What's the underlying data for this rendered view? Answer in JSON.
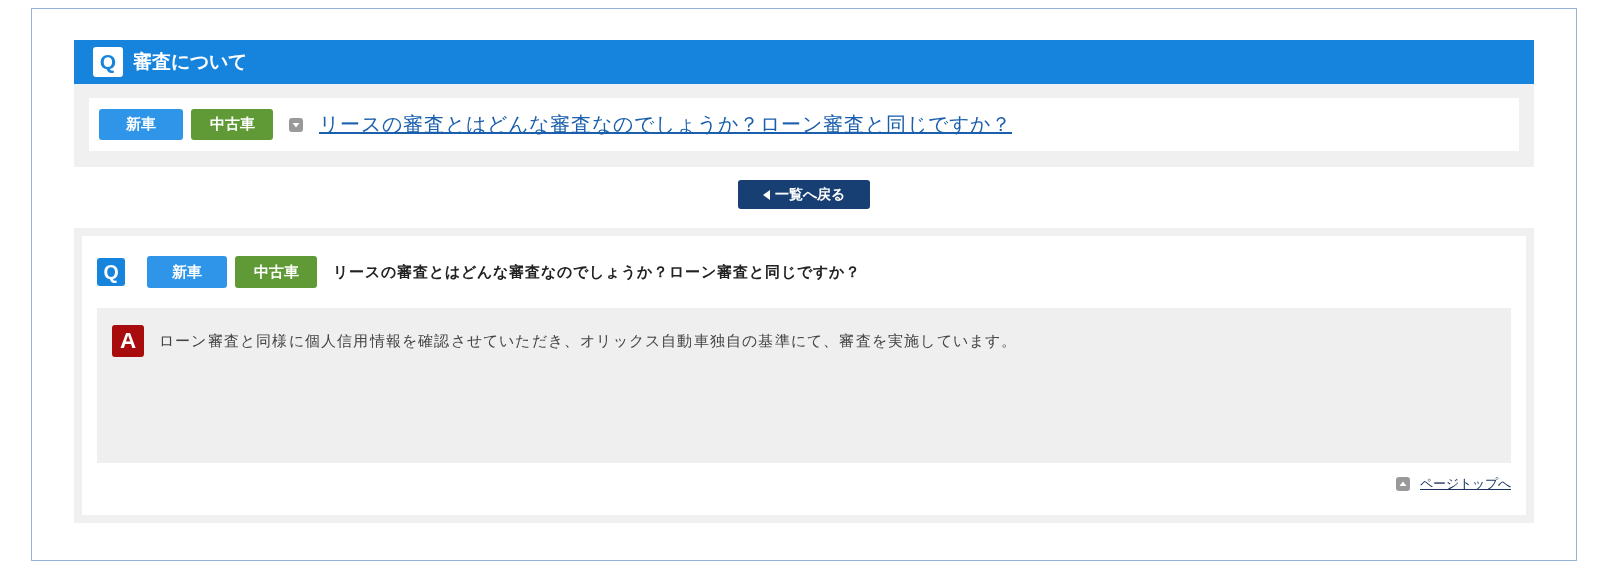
{
  "section": {
    "icon": "Q",
    "title": "審査について"
  },
  "list": [
    {
      "tags": [
        {
          "label": "新車",
          "color": "#2e95e8"
        },
        {
          "label": "中古車",
          "color": "#5f9a36"
        }
      ],
      "question": "リースの審査とはどんな審査なのでしょうか？ローン審査と同じですか？"
    }
  ],
  "back_button": "一覧へ戻る",
  "detail": {
    "q_icon": "Q",
    "tags": [
      {
        "label": "新車",
        "color": "#2e95e8"
      },
      {
        "label": "中古車",
        "color": "#5f9a36"
      }
    ],
    "question": "リースの審査とはどんな審査なのでしょうか？ローン審査と同じですか？",
    "a_icon": "A",
    "answer": "ローン審査と同様に個人信用情報を確認させていただき、オリックス自動車独自の基準にて、審査を実施しています。",
    "page_top": "ページトップへ"
  }
}
